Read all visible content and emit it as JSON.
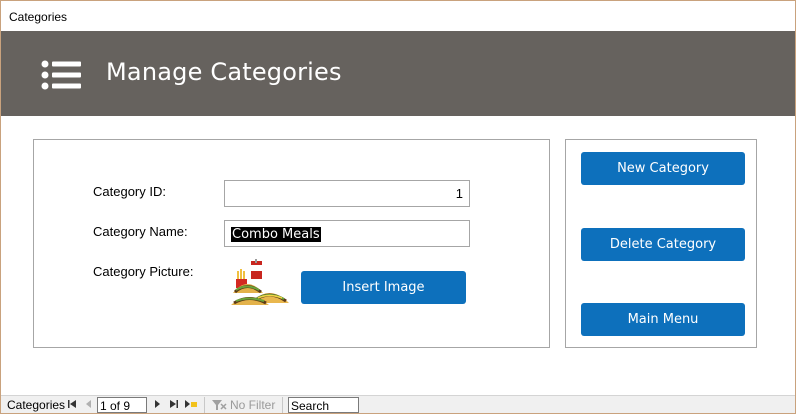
{
  "window": {
    "title": "Categories"
  },
  "header": {
    "title": "Manage Categories",
    "icon": "list-menu-icon"
  },
  "form": {
    "category_id_label": "Category ID:",
    "category_id_value": "1",
    "category_name_label": "Category Name:",
    "category_name_value": "Combo Meals",
    "category_picture_label": "Category Picture:",
    "insert_image_label": "Insert Image"
  },
  "actions": {
    "new_category_label": "New Category",
    "delete_category_label": "Delete Category",
    "main_menu_label": "Main Menu"
  },
  "statusbar": {
    "object_label": "Categories",
    "record_position": "1 of 9",
    "filter_label": "No Filter",
    "search_placeholder": "Search"
  },
  "colors": {
    "header_bg": "#66625e",
    "button_bg": "#0d70bc"
  }
}
